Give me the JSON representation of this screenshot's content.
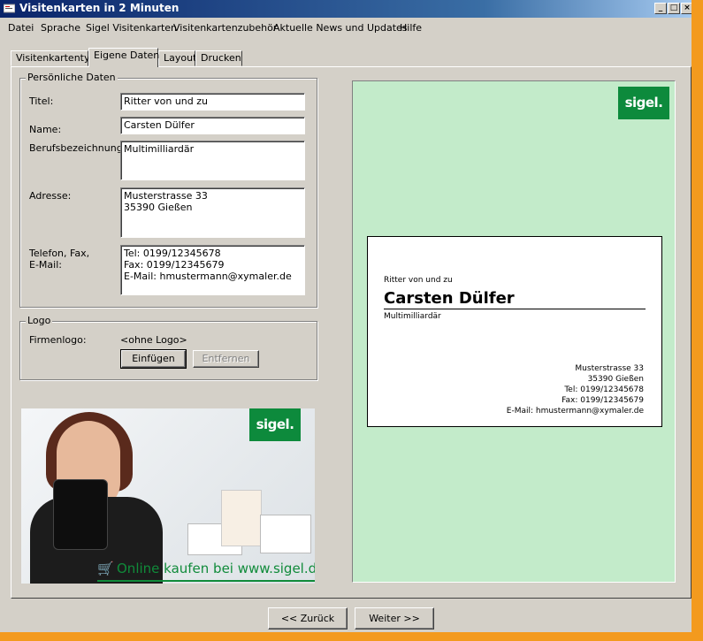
{
  "window": {
    "title": "Visitenkarten in 2 Minuten"
  },
  "menu": [
    "Datei",
    "Sprache",
    "Sigel Visitenkarten",
    "Visitenkartenzubehör",
    "Aktuelle News und Updates",
    "Hilfe"
  ],
  "tabs": [
    "Visitenkartentyp",
    "Eigene Daten",
    "Layout",
    "Drucken"
  ],
  "active_tab": "Eigene Daten",
  "personal": {
    "legend": "Persönliche Daten",
    "title_label": "Titel:",
    "title_value": "Ritter von und zu",
    "name_label": "Name:",
    "name_value": "Carsten Dülfer",
    "job_label": "Berufsbezeichnung:",
    "job_value": "Multimilliardär",
    "address_label": "Adresse:",
    "address_value": "Musterstrasse 33\n35390 Gießen",
    "contact_label": "Telefon, Fax,\nE-Mail:",
    "contact_value": "Tel: 0199/12345678\nFax: 0199/12345679\nE-Mail: hmustermann@xymaler.de"
  },
  "logo": {
    "legend": "Logo",
    "firm_logo_label": "Firmenlogo:",
    "firm_logo_value": "<ohne Logo>",
    "insert_button": "Einfügen",
    "remove_button": "Entfernen"
  },
  "preview": {
    "brand_logo": "sigel.",
    "card": {
      "title": "Ritter von und zu",
      "name": "Carsten Dülfer",
      "job": "Multimilliardär",
      "address_lines": [
        "Musterstrasse 33",
        "35390 Gießen",
        "Tel: 0199/12345678",
        "Fax: 0199/12345679",
        "E-Mail: hmustermann@xymaler.de"
      ]
    }
  },
  "ad": {
    "brand_logo": "sigel.",
    "tagline": "Online kaufen bei www.sigel.de"
  },
  "nav": {
    "back_button": "<< Zurück",
    "next_button": "Weiter >>"
  },
  "colors": {
    "preview_bg": "#c3ebca",
    "brand_green": "#0d8a3c",
    "outer_frame": "#f39a1e"
  }
}
